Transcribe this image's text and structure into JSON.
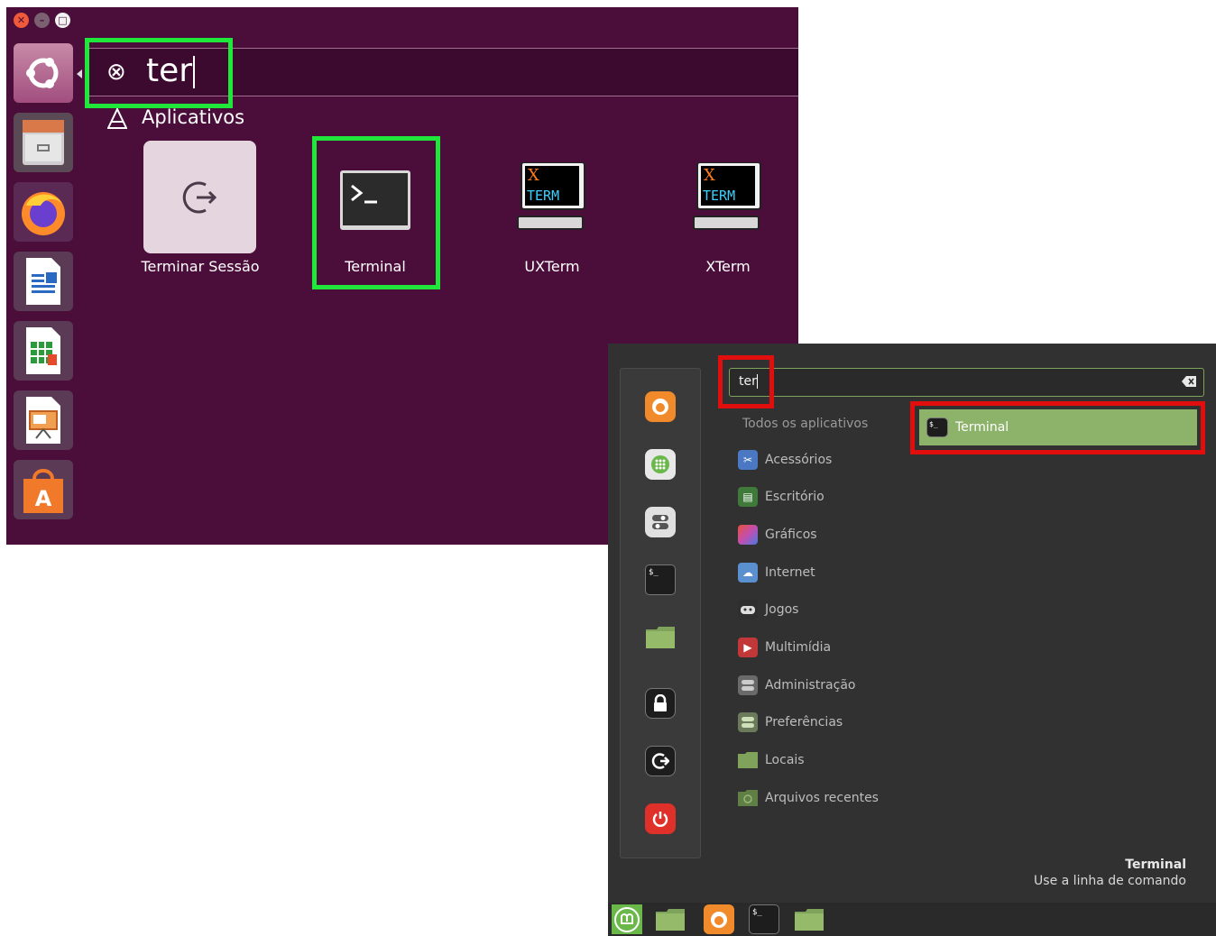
{
  "ubuntu": {
    "window_buttons": {
      "close": "✕",
      "minimize": "–",
      "maximize": "□"
    },
    "search": {
      "clear_icon": "⊗",
      "query": "ter"
    },
    "category": {
      "label": "Aplicativos"
    },
    "apps": [
      {
        "label": "Terminar Sessão",
        "icon": "logout-icon"
      },
      {
        "label": "Terminal",
        "icon": "terminal-icon"
      },
      {
        "label": "UXTerm",
        "icon": "xterm-icon"
      },
      {
        "label": "XTerm",
        "icon": "xterm-icon"
      }
    ],
    "xterm_icon_text": {
      "x": "X",
      "term": "TERM"
    },
    "launcher": [
      "ubuntu-logo-icon",
      "file-cabinet-icon",
      "firefox-icon",
      "writer-icon",
      "calc-icon",
      "impress-icon",
      "software-center-icon"
    ],
    "highlight_color": "#1fe83a"
  },
  "mint": {
    "search": {
      "query": "ter"
    },
    "all_apps": "Todos os aplicativos",
    "categories": [
      {
        "label": "Acessórios",
        "icon": "accessories-icon",
        "color": "#4a78c2"
      },
      {
        "label": "Escritório",
        "icon": "office-icon",
        "color": "#3f7a3a"
      },
      {
        "label": "Gráficos",
        "icon": "graphics-icon",
        "color": "#c24fb0"
      },
      {
        "label": "Internet",
        "icon": "internet-icon",
        "color": "#5a8fd0"
      },
      {
        "label": "Jogos",
        "icon": "games-icon",
        "color": "#2e2e2e"
      },
      {
        "label": "Multimídia",
        "icon": "multimedia-icon",
        "color": "#c23838"
      },
      {
        "label": "Administração",
        "icon": "administration-icon",
        "color": "#6a6a6a"
      },
      {
        "label": "Preferências",
        "icon": "preferences-icon",
        "color": "#6a7a5a"
      },
      {
        "label": "Locais",
        "icon": "folder-icon",
        "color": "#7fa35a"
      },
      {
        "label": "Arquivos recentes",
        "icon": "recent-folder-icon",
        "color": "#5f7f44"
      }
    ],
    "result": {
      "label": "Terminal",
      "icon_text": "$_"
    },
    "description": {
      "title": "Terminal",
      "subtitle": "Use a linha de comando"
    },
    "favorites": [
      "firefox-icon",
      "software-manager-icon",
      "settings-icon",
      "terminal-icon",
      "folder-icon",
      "lock-icon",
      "logout-icon",
      "power-icon"
    ],
    "panel": [
      "mint-menu-icon",
      "folder-icon",
      "firefox-icon",
      "terminal-icon",
      "folder-icon"
    ],
    "terminal_glyph": "$_",
    "highlight_color": "#e20e0e",
    "accent_color": "#8db26a"
  }
}
